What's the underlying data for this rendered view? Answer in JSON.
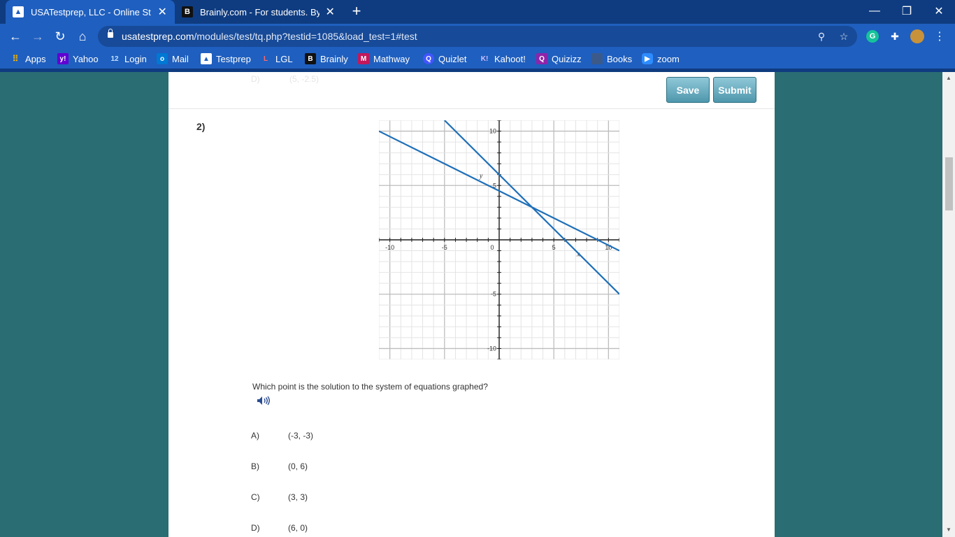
{
  "browser": {
    "tabs": [
      {
        "title": "USATestprep, LLC - Online State-",
        "favicon": "testprep-arrow-icon"
      },
      {
        "title": "Brainly.com - For students. By stu",
        "favicon": "brainly-b-icon"
      }
    ],
    "url_host": "usatestprep.com",
    "url_path": "/modules/test/tq.php?testid=1085&load_test=1#test",
    "bookmarks": [
      {
        "label": "Apps",
        "icon": "apps-grid-icon",
        "color": "#f4b400"
      },
      {
        "label": "Yahoo",
        "icon": "yahoo-icon",
        "color": "#6001d2"
      },
      {
        "label": "Login",
        "icon": "login-12-icon",
        "color": "#1f5fbf"
      },
      {
        "label": "Mail",
        "icon": "outlook-mail-icon",
        "color": "#0078d4"
      },
      {
        "label": "Testprep",
        "icon": "testprep-icon",
        "color": "#1f5fbf"
      },
      {
        "label": "LGL",
        "icon": "lgl-icon",
        "color": "#d32f2f"
      },
      {
        "label": "Brainly",
        "icon": "brainly-icon",
        "color": "#111111"
      },
      {
        "label": "Mathway",
        "icon": "mathway-icon",
        "color": "#c2185b"
      },
      {
        "label": "Quizlet",
        "icon": "quizlet-icon",
        "color": "#4255ff"
      },
      {
        "label": "Kahoot!",
        "icon": "kahoot-icon",
        "color": "#46178f"
      },
      {
        "label": "Quizizz",
        "icon": "quizizz-icon",
        "color": "#8e24aa"
      },
      {
        "label": "Books",
        "icon": "books-icon",
        "color": "#3b5a8a"
      },
      {
        "label": "zoom",
        "icon": "zoom-icon",
        "color": "#2d8cff"
      }
    ]
  },
  "toolbar": {
    "save_label": "Save",
    "submit_label": "Submit"
  },
  "question": {
    "number": "2)",
    "prompt": "Which point is the solution to the system of equations graphed?",
    "options": [
      {
        "letter": "A)",
        "text": "(-3, -3)"
      },
      {
        "letter": "B)",
        "text": "(0, 6)"
      },
      {
        "letter": "C)",
        "text": "(3, 3)"
      },
      {
        "letter": "D)",
        "text": "(6, 0)"
      }
    ],
    "previous_faded_letter": "D)",
    "previous_faded_text": "(5, -2.5)"
  },
  "chart_data": {
    "type": "line",
    "xlim": [
      -11,
      11
    ],
    "ylim": [
      -11,
      11
    ],
    "x_tick_labels": [
      "-10",
      "-5",
      "0",
      "5",
      "10"
    ],
    "y_tick_labels": [
      "10",
      "5",
      "-5",
      "-10"
    ],
    "xlabel": "x",
    "ylabel": "y",
    "grid": true,
    "series": [
      {
        "points": [
          [
            -11,
            10
          ],
          [
            11,
            -1
          ]
        ],
        "color": "#1e6fb8"
      },
      {
        "points": [
          [
            -5,
            11
          ],
          [
            11,
            -5
          ]
        ],
        "color": "#1e6fb8"
      }
    ]
  }
}
